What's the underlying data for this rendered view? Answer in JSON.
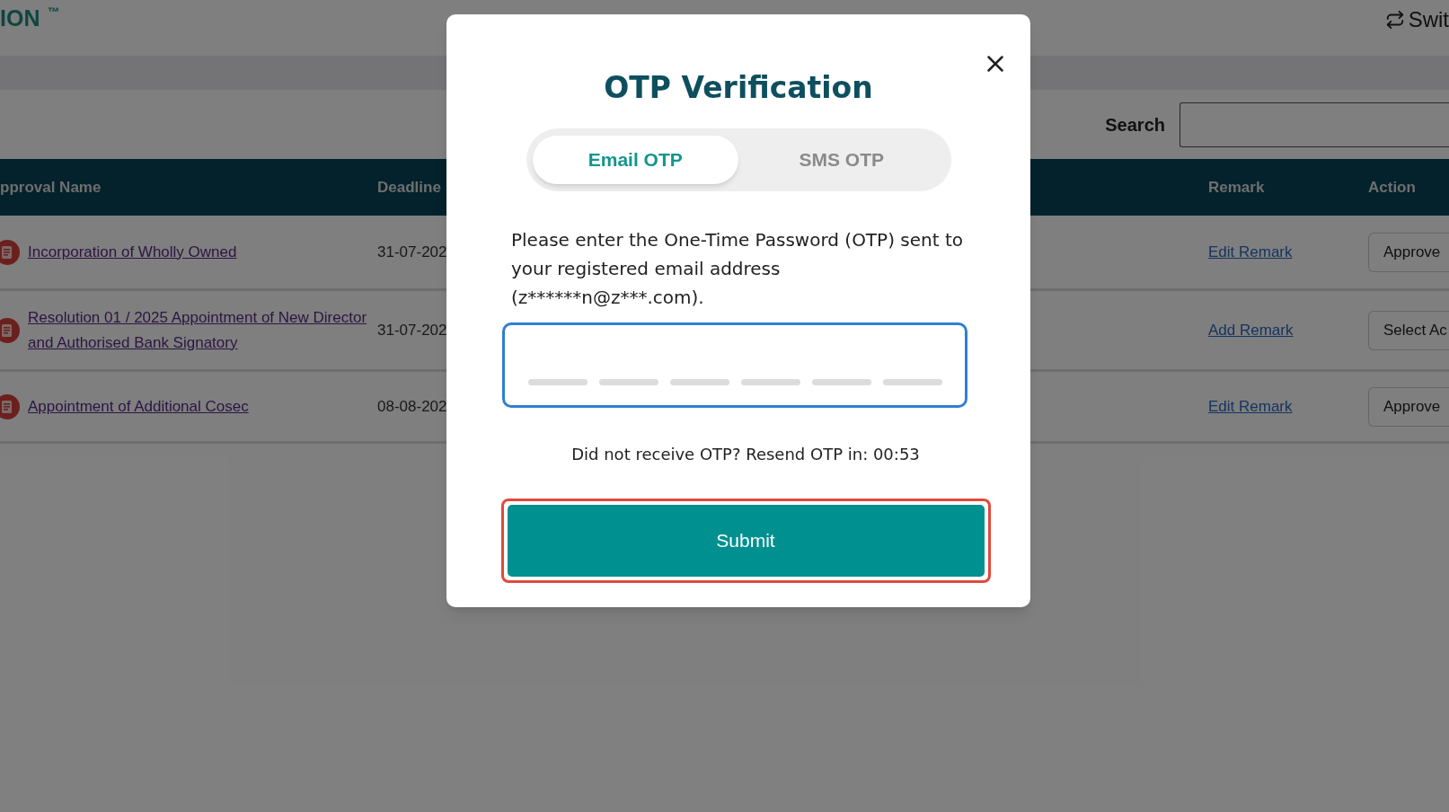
{
  "header": {
    "logo": "ION",
    "trademark": "™",
    "switch_label": "Swit"
  },
  "search": {
    "label": "Search"
  },
  "table": {
    "columns": [
      "pproval Name",
      "Deadline",
      "Remark",
      "Action"
    ],
    "rows": [
      {
        "name": "Incorporation of Wholly Owned",
        "deadline": "31-07-202",
        "remark": "Edit Remark",
        "action": "Approve"
      },
      {
        "name": "Resolution 01 / 2025 Appointment of New Director and Authorised Bank Signatory",
        "deadline": "31-07-202",
        "remark": "Add Remark",
        "action": "Select Ac"
      },
      {
        "name": "Appointment of Additional Cosec",
        "deadline": "08-08-202",
        "remark": "Edit Remark",
        "action": "Approve"
      }
    ]
  },
  "modal": {
    "title": "OTP Verification",
    "tabs": [
      {
        "label": "Email OTP",
        "selected": true
      },
      {
        "label": "SMS OTP",
        "selected": false
      }
    ],
    "message": "Please enter the One-Time Password (OTP) sent to your registered email address (z******n@z***.com).",
    "resend_text": "Did not receive OTP? Resend OTP in: 00:53",
    "submit": "Submit"
  }
}
